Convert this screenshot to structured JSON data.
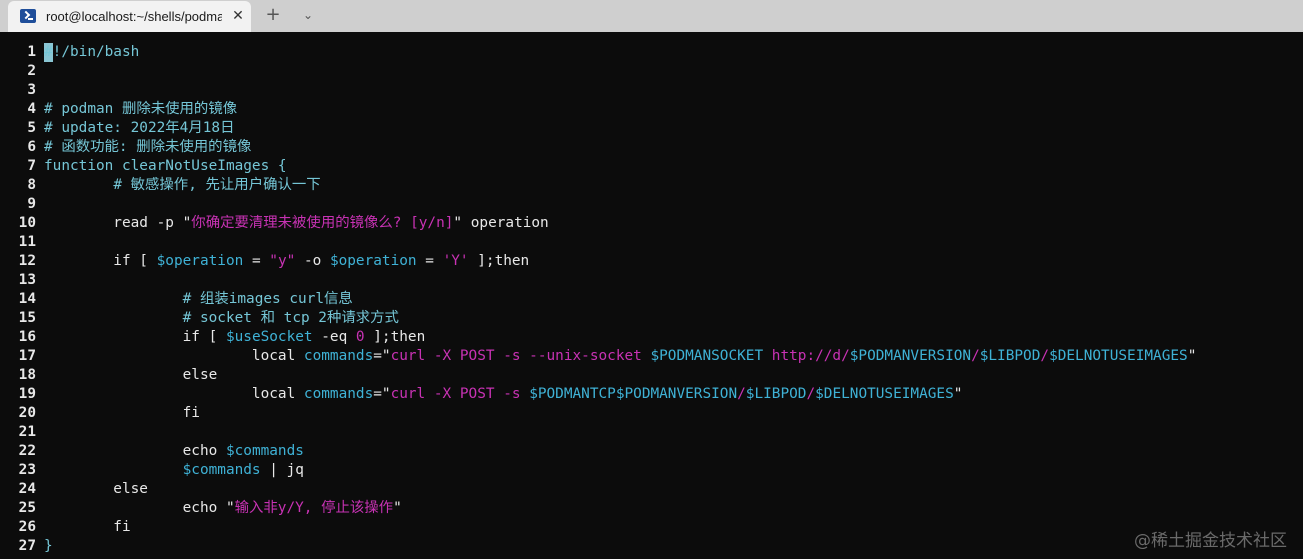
{
  "tab": {
    "title": "root@localhost:~/shells/podma",
    "close_glyph": "✕",
    "icon": "powershell-icon"
  },
  "tabbar": {
    "new_tab_glyph": "+",
    "dropdown_glyph": "⌄"
  },
  "colors": {
    "background": "#0c0c0c",
    "text": "#e8e8e8",
    "comment": "#75c6d6",
    "variable": "#3fb2d6",
    "string": "#c832b4",
    "line_number": "#e8e8e8"
  },
  "watermark": "@稀土掘金技术社区",
  "lines": [
    {
      "n": "1",
      "segs": [
        {
          "t": "#!/bin/bash",
          "c": "comment"
        }
      ]
    },
    {
      "n": "2",
      "segs": []
    },
    {
      "n": "3",
      "segs": []
    },
    {
      "n": "4",
      "segs": [
        {
          "t": "# podman 删除未使用的镜像",
          "c": "comment"
        }
      ]
    },
    {
      "n": "5",
      "segs": [
        {
          "t": "# update: 2022年4月18日",
          "c": "comment"
        }
      ]
    },
    {
      "n": "6",
      "segs": [
        {
          "t": "# 函数功能: 删除未使用的镜像",
          "c": "comment"
        }
      ]
    },
    {
      "n": "7",
      "segs": [
        {
          "t": "function clearNotUseImages {",
          "c": "comment"
        }
      ]
    },
    {
      "n": "8",
      "segs": [
        {
          "t": "        ",
          "c": "text"
        },
        {
          "t": "# 敏感操作, 先让用户确认一下",
          "c": "comment"
        }
      ]
    },
    {
      "n": "9",
      "segs": []
    },
    {
      "n": "10",
      "segs": [
        {
          "t": "        read -p ",
          "c": "text"
        },
        {
          "t": "\"",
          "c": "text"
        },
        {
          "t": "你确定要清理未被使用的镜像么? [y/n]",
          "c": "string"
        },
        {
          "t": "\" operation",
          "c": "text"
        }
      ]
    },
    {
      "n": "11",
      "segs": []
    },
    {
      "n": "12",
      "segs": [
        {
          "t": "        if [ ",
          "c": "text"
        },
        {
          "t": "$operation",
          "c": "variable"
        },
        {
          "t": " = ",
          "c": "text"
        },
        {
          "t": "\"y\"",
          "c": "string"
        },
        {
          "t": " -o ",
          "c": "text"
        },
        {
          "t": "$operation",
          "c": "variable"
        },
        {
          "t": " = ",
          "c": "text"
        },
        {
          "t": "'Y'",
          "c": "string"
        },
        {
          "t": " ];then",
          "c": "text"
        }
      ]
    },
    {
      "n": "13",
      "segs": []
    },
    {
      "n": "14",
      "segs": [
        {
          "t": "                ",
          "c": "text"
        },
        {
          "t": "# 组装images curl信息",
          "c": "comment"
        }
      ]
    },
    {
      "n": "15",
      "segs": [
        {
          "t": "                ",
          "c": "text"
        },
        {
          "t": "# socket 和 tcp 2种请求方式",
          "c": "comment"
        }
      ]
    },
    {
      "n": "16",
      "segs": [
        {
          "t": "                if [ ",
          "c": "text"
        },
        {
          "t": "$useSocket",
          "c": "variable"
        },
        {
          "t": " -eq ",
          "c": "text"
        },
        {
          "t": "0",
          "c": "string"
        },
        {
          "t": " ];then",
          "c": "text"
        }
      ]
    },
    {
      "n": "17",
      "segs": [
        {
          "t": "                        local ",
          "c": "text"
        },
        {
          "t": "commands",
          "c": "variable"
        },
        {
          "t": "=\"",
          "c": "text"
        },
        {
          "t": "curl -X POST -s --unix-socket ",
          "c": "string"
        },
        {
          "t": "$PODMANSOCKET",
          "c": "variable"
        },
        {
          "t": " http://d/",
          "c": "string"
        },
        {
          "t": "$PODMANVERSION",
          "c": "variable"
        },
        {
          "t": "/",
          "c": "string"
        },
        {
          "t": "$LIBPOD",
          "c": "variable"
        },
        {
          "t": "/",
          "c": "string"
        },
        {
          "t": "$DELNOTUSEIMAGES",
          "c": "variable"
        },
        {
          "t": "\"",
          "c": "text"
        }
      ]
    },
    {
      "n": "18",
      "segs": [
        {
          "t": "                else",
          "c": "text"
        }
      ]
    },
    {
      "n": "19",
      "segs": [
        {
          "t": "                        local ",
          "c": "text"
        },
        {
          "t": "commands",
          "c": "variable"
        },
        {
          "t": "=\"",
          "c": "text"
        },
        {
          "t": "curl -X POST -s ",
          "c": "string"
        },
        {
          "t": "$PODMANTCP",
          "c": "variable"
        },
        {
          "t": "$PODMANVERSION",
          "c": "variable"
        },
        {
          "t": "/",
          "c": "string"
        },
        {
          "t": "$LIBPOD",
          "c": "variable"
        },
        {
          "t": "/",
          "c": "string"
        },
        {
          "t": "$DELNOTUSEIMAGES",
          "c": "variable"
        },
        {
          "t": "\"",
          "c": "text"
        }
      ]
    },
    {
      "n": "20",
      "segs": [
        {
          "t": "                fi",
          "c": "text"
        }
      ]
    },
    {
      "n": "21",
      "segs": []
    },
    {
      "n": "22",
      "segs": [
        {
          "t": "                echo ",
          "c": "text"
        },
        {
          "t": "$commands",
          "c": "variable"
        }
      ]
    },
    {
      "n": "23",
      "segs": [
        {
          "t": "                ",
          "c": "text"
        },
        {
          "t": "$commands",
          "c": "variable"
        },
        {
          "t": " | jq",
          "c": "text"
        }
      ]
    },
    {
      "n": "24",
      "segs": [
        {
          "t": "        else",
          "c": "text"
        }
      ]
    },
    {
      "n": "25",
      "segs": [
        {
          "t": "                echo ",
          "c": "text"
        },
        {
          "t": "\"",
          "c": "text"
        },
        {
          "t": "输入非y/Y, 停止该操作",
          "c": "string"
        },
        {
          "t": "\"",
          "c": "text"
        }
      ]
    },
    {
      "n": "26",
      "segs": [
        {
          "t": "        fi",
          "c": "text"
        }
      ]
    },
    {
      "n": "27",
      "segs": [
        {
          "t": "}",
          "c": "comment"
        }
      ]
    }
  ]
}
